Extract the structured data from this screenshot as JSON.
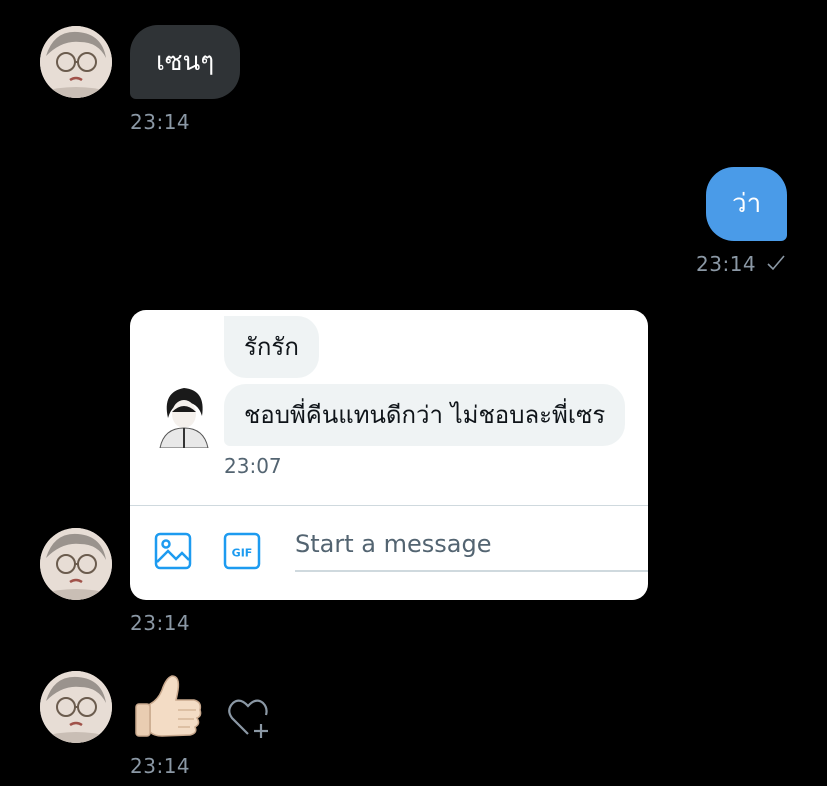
{
  "messages": {
    "m1": {
      "text": "เซนๆ",
      "time": "23:14"
    },
    "m2": {
      "text": "ว่า",
      "time": "23:14",
      "status_icon": "check-icon"
    },
    "m3": {
      "time": "23:14"
    },
    "m4": {
      "emoji": "👍🏻",
      "time": "23:14",
      "reaction_icon": "heart-plus-icon"
    }
  },
  "embedded_screenshot": {
    "bubble1": "รักรัก",
    "bubble2": "ชอบพี่คีนแทนดีกว่า ไม่ชอบละพี่เซร",
    "time": "23:07",
    "composer": {
      "placeholder": "Start a message",
      "icons": [
        "image-icon",
        "gif-icon"
      ],
      "gif_label": "GIF"
    }
  },
  "colors": {
    "background": "#000000",
    "incoming_bubble": "#2f3336",
    "outgoing_bubble": "#4a9be8",
    "timestamp": "#8b98a5",
    "accent": "#1d9bf0"
  }
}
